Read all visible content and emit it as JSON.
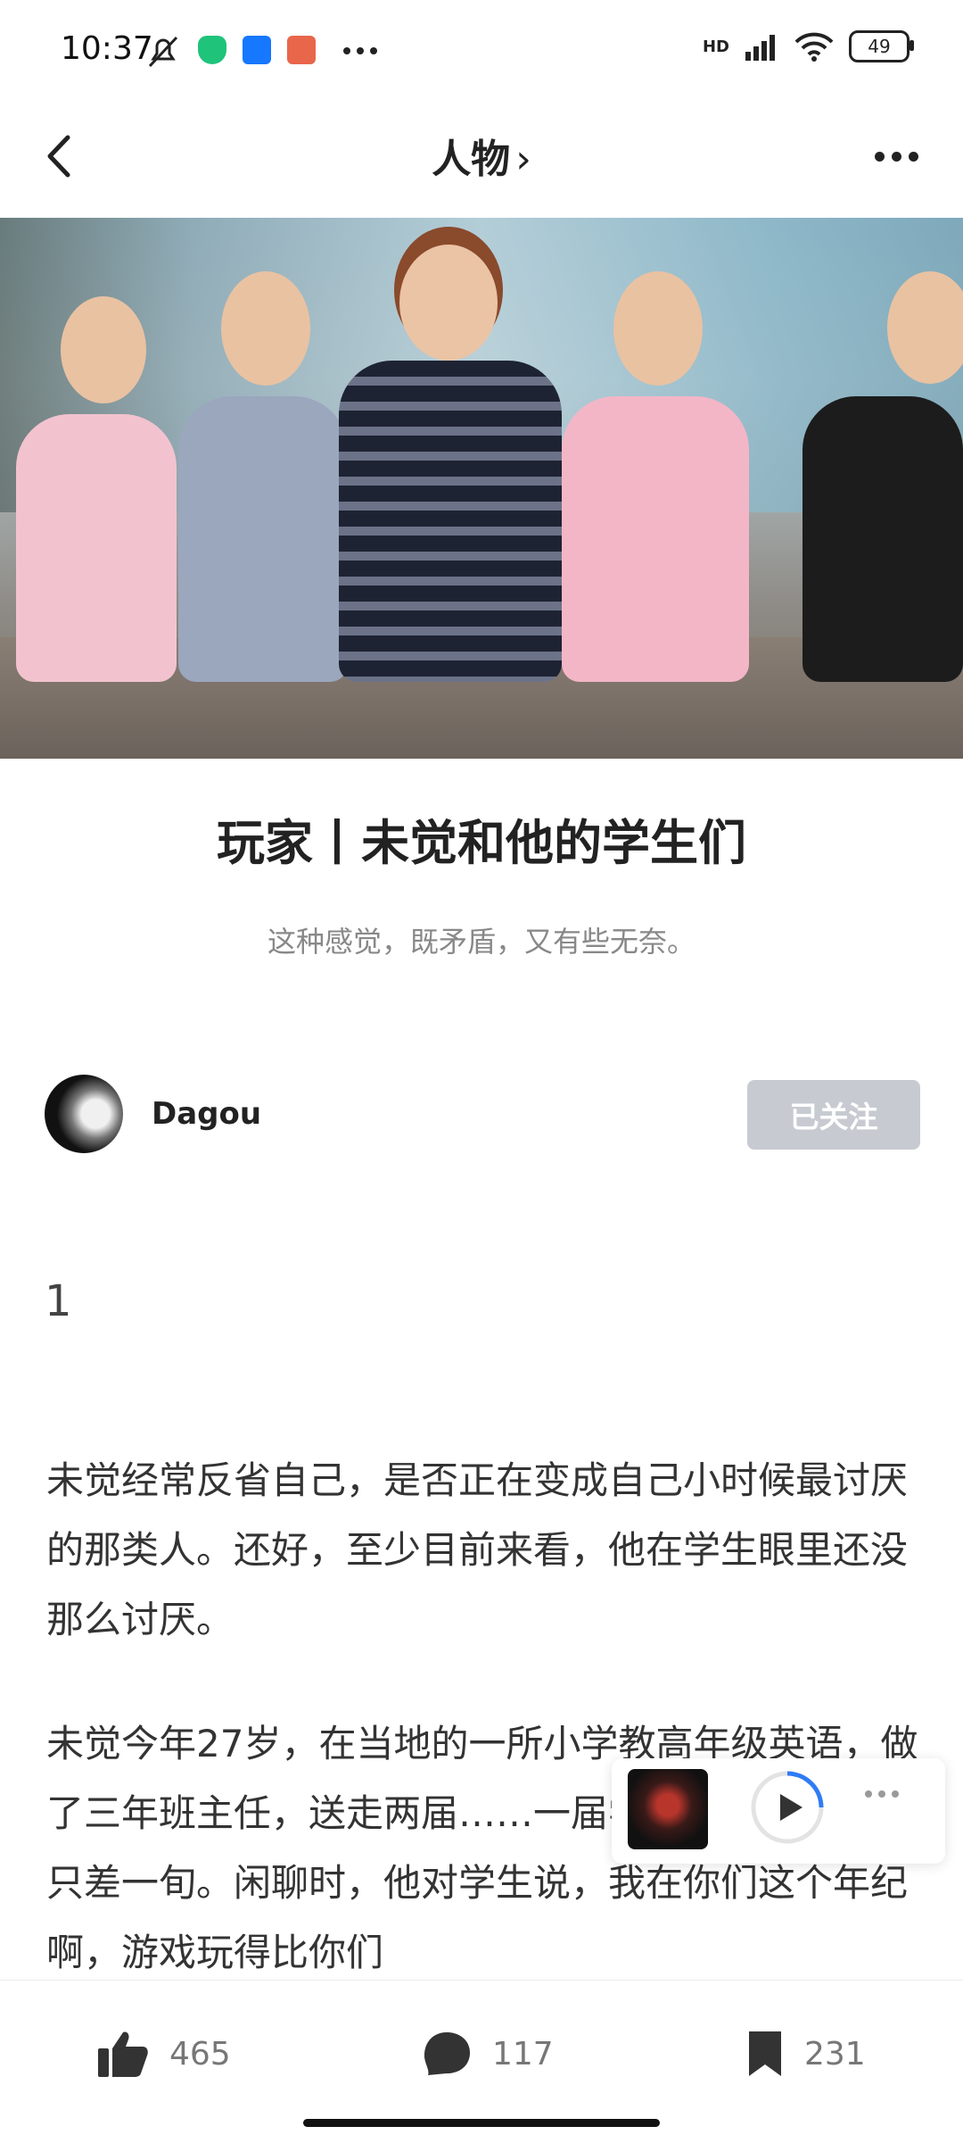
{
  "status_bar": {
    "time": "10:37",
    "network_label": "HD",
    "battery": "49",
    "icons": [
      "mute-bell-icon",
      "shield-app-icon",
      "alipay-icon",
      "mi-icon",
      "more-dots-icon",
      "signal-icon",
      "wifi-icon",
      "battery-icon"
    ]
  },
  "nav": {
    "back_icon": "chevron-left-icon",
    "title": "人物",
    "title_chevron": "›",
    "more_icon": "more-dots-icon"
  },
  "hero": {
    "description_icon": "cover-photo"
  },
  "article": {
    "title": "玩家丨未觉和他的学生们",
    "subtitle": "这种感觉，既矛盾，又有些无奈。"
  },
  "author": {
    "name": "Dagou",
    "follow_label": "已关注"
  },
  "body": {
    "section_number": "1",
    "paragraphs": [
      "未觉经常反省自己，是否正在变成自己小时候最讨厌的那类人。还好，至少目前来看，他在学生眼里还没那么讨厌。",
      "未觉今年27岁，在当地的一所小学教高年级英语，做了三年班主任，送走两届……一届学生之间的年龄，只差一旬。闲聊时，他对学生说，我在你们这个年纪啊，游戏玩得比你们"
    ]
  },
  "player": {
    "play_icon": "play-icon",
    "more_icon": "more-dots-icon"
  },
  "actions": {
    "like_count": "465",
    "comment_count": "117",
    "bookmark_count": "231"
  },
  "colors": {
    "follow_bg": "#c7cbd1",
    "text_primary": "#222222",
    "text_secondary": "#888888"
  }
}
